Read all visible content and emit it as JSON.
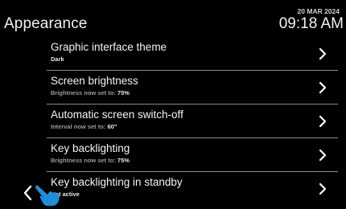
{
  "header": {
    "title": "Appearance",
    "date": "20 MAR 2024",
    "time": "09:18 AM"
  },
  "items": [
    {
      "label": "Graphic interface theme",
      "sub_prefix": "",
      "sub_value": "Dark"
    },
    {
      "label": "Screen brightness",
      "sub_prefix": "Brightness now set to: ",
      "sub_value": "75%"
    },
    {
      "label": "Automatic screen switch-off",
      "sub_prefix": "Interval now set to: ",
      "sub_value": "60\""
    },
    {
      "label": "Key backlighting",
      "sub_prefix": "Brightness now set to: ",
      "sub_value": "75%"
    },
    {
      "label": "Key backlighting in standby",
      "sub_prefix": "",
      "sub_value": "Not active"
    }
  ],
  "colors": {
    "background": "#000000",
    "text": "#f5f5f5",
    "subtext": "#9a9a9a",
    "divider": "#8a8a8a",
    "hand_icon": "#1e8fd6"
  },
  "icons": {
    "item_arrow": "chevron-right-icon",
    "back": "chevron-left-icon",
    "touch_hint": "pointing-hand-icon"
  }
}
